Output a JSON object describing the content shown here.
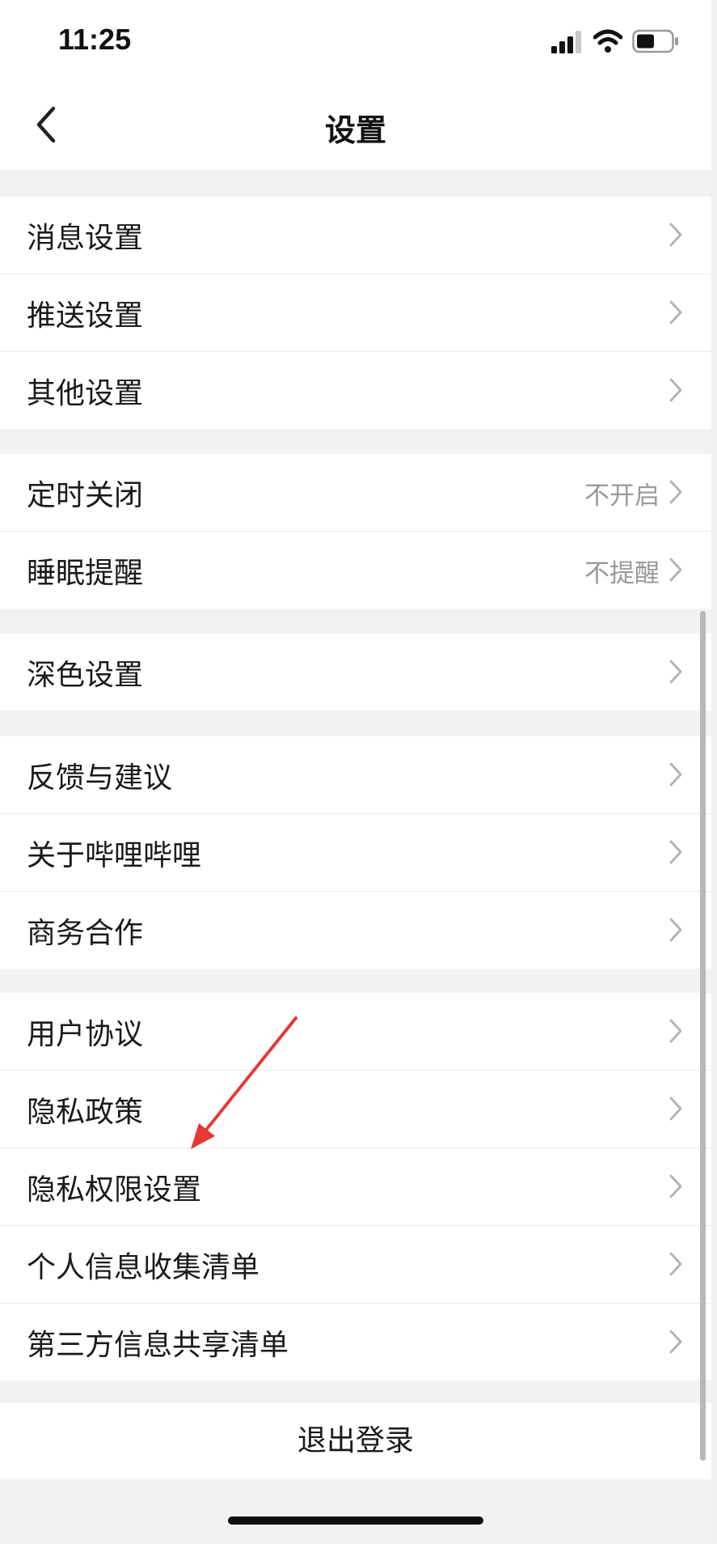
{
  "status_bar": {
    "time": "11:25"
  },
  "nav": {
    "title": "设置"
  },
  "groups": [
    {
      "items": [
        {
          "label": "消息设置"
        },
        {
          "label": "推送设置"
        },
        {
          "label": "其他设置"
        }
      ]
    },
    {
      "items": [
        {
          "label": "定时关闭",
          "value": "不开启"
        },
        {
          "label": "睡眠提醒",
          "value": "不提醒"
        }
      ]
    },
    {
      "items": [
        {
          "label": "深色设置"
        }
      ]
    },
    {
      "items": [
        {
          "label": "反馈与建议"
        },
        {
          "label": "关于哔哩哔哩"
        },
        {
          "label": "商务合作"
        }
      ]
    },
    {
      "items": [
        {
          "label": "用户协议"
        },
        {
          "label": "隐私政策"
        },
        {
          "label": "隐私权限设置"
        },
        {
          "label": "个人信息收集清单"
        },
        {
          "label": "第三方信息共享清单"
        }
      ]
    }
  ],
  "logout": {
    "label": "退出登录"
  },
  "colors": {
    "annotation_arrow": "#e53935",
    "background": "#f1f2f3"
  }
}
